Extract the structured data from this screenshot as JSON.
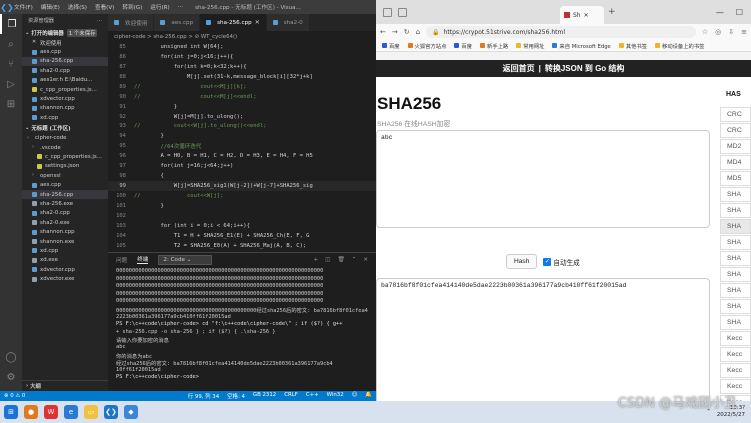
{
  "vscode": {
    "menu": [
      "文件(F)",
      "编辑(E)",
      "选择(S)",
      "查看(V)",
      "转到(G)",
      "运行(R)",
      "..."
    ],
    "window_title": "sha-256.cpp - 无标题 (工作区) - Visua...",
    "explorer_header": "资源管理器",
    "open_editors": {
      "label": "打开的编辑器",
      "badge": "1 个未保存"
    },
    "open_files": [
      {
        "name": "欢迎使用",
        "icon": "x"
      },
      {
        "name": "aes.cpp",
        "icon": "cpp"
      },
      {
        "name": "sha-256.cpp",
        "icon": "cpp",
        "selected": true
      },
      {
        "name": "sha2-0.cpp",
        "icon": "cpp"
      },
      {
        "name": "aes1er.h  E:\\Baidu...",
        "icon": "cpp"
      },
      {
        "name": "c_cpp_properties.js...",
        "icon": "json"
      },
      {
        "name": "xdvector.cpp",
        "icon": "cpp"
      },
      {
        "name": "shannon.cpp",
        "icon": "cpp"
      },
      {
        "name": "xd.cpp",
        "icon": "cpp"
      }
    ],
    "workspace": "无标题 (工作区)",
    "tree": [
      {
        "name": "cipher-code",
        "icon": "folder",
        "indent": 1
      },
      {
        "name": ".vscode",
        "icon": "folder",
        "indent": 2
      },
      {
        "name": "c_cpp_properties.js...",
        "icon": "json",
        "indent": 3
      },
      {
        "name": "settings.json",
        "icon": "json",
        "indent": 3
      },
      {
        "name": "openssl",
        "icon": "folder",
        "indent": 2
      },
      {
        "name": "aes.cpp",
        "icon": "cpp",
        "indent": 2
      },
      {
        "name": "sha-256.cpp",
        "icon": "cpp",
        "indent": 2,
        "selected": true
      },
      {
        "name": "sha-256.exe",
        "icon": "exe",
        "indent": 2
      },
      {
        "name": "sha2-0.cpp",
        "icon": "cpp",
        "indent": 2
      },
      {
        "name": "sha2-0.exe",
        "icon": "exe",
        "indent": 2
      },
      {
        "name": "shannon.cpp",
        "icon": "cpp",
        "indent": 2
      },
      {
        "name": "shannon.exe",
        "icon": "exe",
        "indent": 2
      },
      {
        "name": "xd.cpp",
        "icon": "cpp",
        "indent": 2
      },
      {
        "name": "xd.exe",
        "icon": "exe",
        "indent": 2
      },
      {
        "name": "xdvector.cpp",
        "icon": "cpp",
        "indent": 2
      },
      {
        "name": "xdvector.exe",
        "icon": "exe",
        "indent": 2
      }
    ],
    "outline": "大纲",
    "tabs": [
      {
        "label": "欢迎使用",
        "active": false
      },
      {
        "label": "aes.cpp",
        "active": false
      },
      {
        "label": "sha-256.cpp",
        "active": true
      },
      {
        "label": "sha2-0",
        "active": false
      }
    ],
    "breadcrumb": "cipher-code > sha-256.cpp > ⊘ WT_cycle64()",
    "code": [
      {
        "n": "85",
        "t": "        unsigned int W[64];"
      },
      {
        "n": "86",
        "t": "        for(int j=0;j<16;j++){"
      },
      {
        "n": "87",
        "t": "            for(int k=0;k<32;k++){"
      },
      {
        "n": "88",
        "t": "                M[j].set(31-k,message_block[i][32*j+k]"
      },
      {
        "n": "89",
        "t": "//                  cout<<M[j][k];"
      },
      {
        "n": "90",
        "t": "//                  cout<<M[j]<<endl;"
      },
      {
        "n": "91",
        "t": "            }"
      },
      {
        "n": "92",
        "t": "            W[j]=M[j].to_ulong();"
      },
      {
        "n": "93",
        "t": "//          cout<<W[j].to_ulong()<<endl;"
      },
      {
        "n": "94",
        "t": "        }"
      },
      {
        "n": "95",
        "t": "        //64次循环迭代"
      },
      {
        "n": "96",
        "t": "        A = H0, B = H1, C = H2, D = H3, E = H4, F = H5"
      },
      {
        "n": "97",
        "t": "        for(int j=16;j<64;j++)"
      },
      {
        "n": "98",
        "t": "        {"
      },
      {
        "n": "99",
        "t": "            W[j]=SHA256_sig1(W[j-2])+W[j-7]+SHA256_sig",
        "cur": true
      },
      {
        "n": "100",
        "t": "//              cout<<W[j];"
      },
      {
        "n": "101",
        "t": "        }"
      },
      {
        "n": "102",
        "t": ""
      },
      {
        "n": "103",
        "t": "        for (int i = 0;i < 64;i++){"
      },
      {
        "n": "104",
        "t": "            T1 = H + SHA256_E1(E) + SHA256_Ch(E, F, G"
      },
      {
        "n": "105",
        "t": "            T2 = SHA256_E0(A) + SHA256_Maj(A, B, C);"
      },
      {
        "n": "106",
        "t": "            H = G, G = F, F = E, E = D + T1, D = C, C"
      }
    ],
    "panel_tabs": [
      "问题",
      "终端"
    ],
    "terminal_select": "2: Code",
    "terminal": [
      "00000000000000000000000000000000000000000000000000000000000000000",
      "00000000000000000000000000000000000000000000000000000000000000000",
      "00000000000000000000000000000000000000000000000000000000000000000",
      "00000000000000000000000000000000000000000000000000000000000000000",
      "00000000000000000000000000000000000000000000000000000000000000000",
      "00000000000000000000000000000000000000000000经过sha256后的密文: ba7816bf8f01cfea414140de5dae",
      "2223b00361a396177a9cb410ff61f20015ad",
      "PS F:\\c++code\\cipher-code> cd \"f:\\c++code\\cipher-code\\\" ; if ($?) { g++",
      "+ sha-256.cpp -o sha-256 } ; if ($?) { .\\sha-256 }",
      "请输入你要加密的消息",
      "abc",
      "你的消息为abc",
      "经过sha256后的密文: ba7816bf8f01cfea414140de5dae2223b00361a396177a9cb4",
      "10ff61f20015ad",
      "PS F:\\c++code\\cipher-code> "
    ],
    "status_left": "⊗ 0 ⚠ 0",
    "status_right": [
      "行 99, 列 34",
      "空格: 4",
      "GB 2312",
      "CRLF",
      "C++",
      "Win32",
      "☺",
      "🔔"
    ]
  },
  "browser": {
    "tab_title": "Sh",
    "url": "https://crypot.51strive.com/sha256.html",
    "bookmarks": [
      "百度",
      "火狐官方站点",
      "百度",
      "新手上路",
      "常用网址",
      "来自 Microsoft Edge",
      "其他书签",
      "移动设备上的书签"
    ],
    "nav_links": [
      "返回首页",
      "转换JSON 到 Go 结构"
    ],
    "title": "SHA256",
    "subtitle": "SHA256 在线HASH加密",
    "input_value": "abc",
    "hash_button": "Hash",
    "auto_label": "自动生成",
    "auto_checked": true,
    "output_value": "ba7816bf8f01cfea414140de5dae2223b00361a396177a9cb410ff61f20015ad",
    "side_header": "HAS",
    "side_items": [
      {
        "label": "CRC",
        "hl": false
      },
      {
        "label": "CRC",
        "hl": false
      },
      {
        "label": "MD2",
        "hl": false
      },
      {
        "label": "MD4",
        "hl": false
      },
      {
        "label": "MD5",
        "hl": false
      },
      {
        "label": "SHA",
        "hl": false
      },
      {
        "label": "SHA",
        "hl": false
      },
      {
        "label": "SHA",
        "hl": true
      },
      {
        "label": "SHA",
        "hl": false
      },
      {
        "label": "SHA",
        "hl": false
      },
      {
        "label": "SHA",
        "hl": false
      },
      {
        "label": "SHA",
        "hl": false
      },
      {
        "label": "SHA",
        "hl": false
      },
      {
        "label": "SHA",
        "hl": false
      },
      {
        "label": "Kecc",
        "hl": false
      },
      {
        "label": "Kecc",
        "hl": false
      },
      {
        "label": "Kecc",
        "hl": false
      },
      {
        "label": "Kecc",
        "hl": false
      },
      {
        "label": "Kecc",
        "hl": false
      }
    ]
  },
  "watermark": "CSDN @马戏团小丑",
  "taskbar": {
    "time": "10:3?",
    "date": "2022/5/27"
  }
}
